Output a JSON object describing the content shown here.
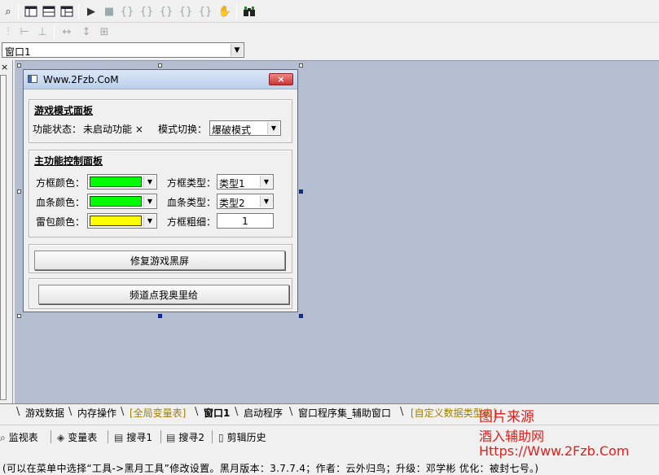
{
  "combo": {
    "value": "窗口1"
  },
  "toolbar": {
    "icons": [
      "search-icon",
      "layout-icon",
      "layout2-icon",
      "layout3-icon",
      "run-icon",
      "stop-icon",
      "step-into-icon",
      "step-over-icon",
      "step-out-icon",
      "breakpoint-icon",
      "hand-icon",
      "binoculars-icon"
    ]
  },
  "dialog": {
    "title": "Www.2Fzb.CoM",
    "close": "×",
    "game_panel": {
      "title": "游戏模式面板",
      "status_label": "功能状态：",
      "status_value": "未启动功能 ×",
      "mode_label": "模式切换：",
      "mode_value": "爆破模式"
    },
    "main_panel": {
      "title": "主功能控制面板",
      "box_color_label": "方框颜色：",
      "box_color": "#00ff00",
      "hp_color_label": "血条颜色：",
      "hp_color": "#00ff00",
      "mine_color_label": "雷包颜色：",
      "mine_color": "#ffff00",
      "box_type_label": "方框类型：",
      "box_type_value": "类型1",
      "hp_type_label": "血条类型：",
      "hp_type_value": "类型2",
      "box_width_label": "方框粗细：",
      "box_width_value": "1"
    },
    "fix_button": "修复游戏黑屏",
    "channel_button": "频道点我奥里给"
  },
  "tabs": [
    {
      "label": "游戏数据",
      "state": "normal"
    },
    {
      "label": "内存操作",
      "state": "normal"
    },
    {
      "label": "[全局变量表]",
      "state": "yellow"
    },
    {
      "label": "窗口1",
      "state": "active"
    },
    {
      "label": "启动程序",
      "state": "normal"
    },
    {
      "label": "窗口程序集_辅助窗口",
      "state": "normal"
    },
    {
      "label": "[自定义数据类型表]",
      "state": "yellow"
    }
  ],
  "panels": {
    "watch": "监视表",
    "vars": "变量表",
    "search1": "搜寻1",
    "search2": "搜寻2",
    "clip": "剪辑历史"
  },
  "status": {
    "text": "(可以在菜单中选择“工具->黑月工具”修改设置。黑月版本：3.7.7.4；作者：云外归鸟；升级：邓学彬 优化：被封七号。)"
  },
  "watermark": {
    "line1": "图片来源",
    "line2": "酒入辅助网",
    "line3": "Https://Www.2Fzb.Com"
  },
  "colors": {
    "canvas": "#b4bed0",
    "watermark": "#e0201c"
  }
}
